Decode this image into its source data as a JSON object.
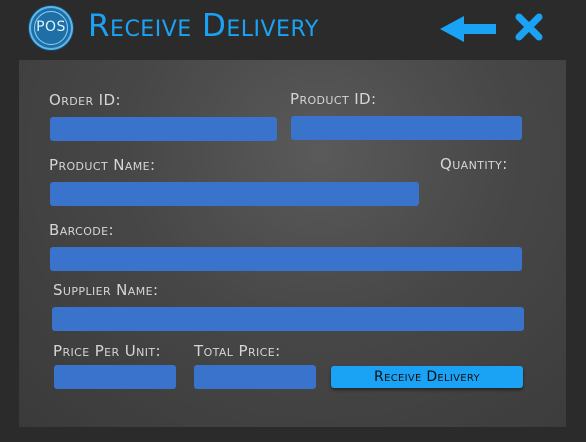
{
  "window": {
    "logo_text": "POS",
    "title": "Receive Delivery",
    "back_icon": "arrow-left-icon",
    "close_icon": "close-x-icon"
  },
  "form": {
    "order_id": {
      "label": "Order ID:",
      "value": ""
    },
    "product_id": {
      "label": "Product ID:",
      "value": ""
    },
    "product_name": {
      "label": "Product Name:",
      "value": ""
    },
    "quantity": {
      "label": "Quantity:"
    },
    "barcode": {
      "label": "Barcode:",
      "value": ""
    },
    "supplier_name": {
      "label": "Supplier Name:",
      "value": ""
    },
    "price_per_unit": {
      "label": "Price Per Unit:",
      "value": ""
    },
    "total_price": {
      "label": "Total Price:",
      "value": ""
    },
    "submit_label": "Receive Delivery"
  },
  "colors": {
    "accent": "#1aa3f5",
    "field": "#3a73cc",
    "background": "#2b2b2b",
    "label": "#d6d6d6"
  }
}
